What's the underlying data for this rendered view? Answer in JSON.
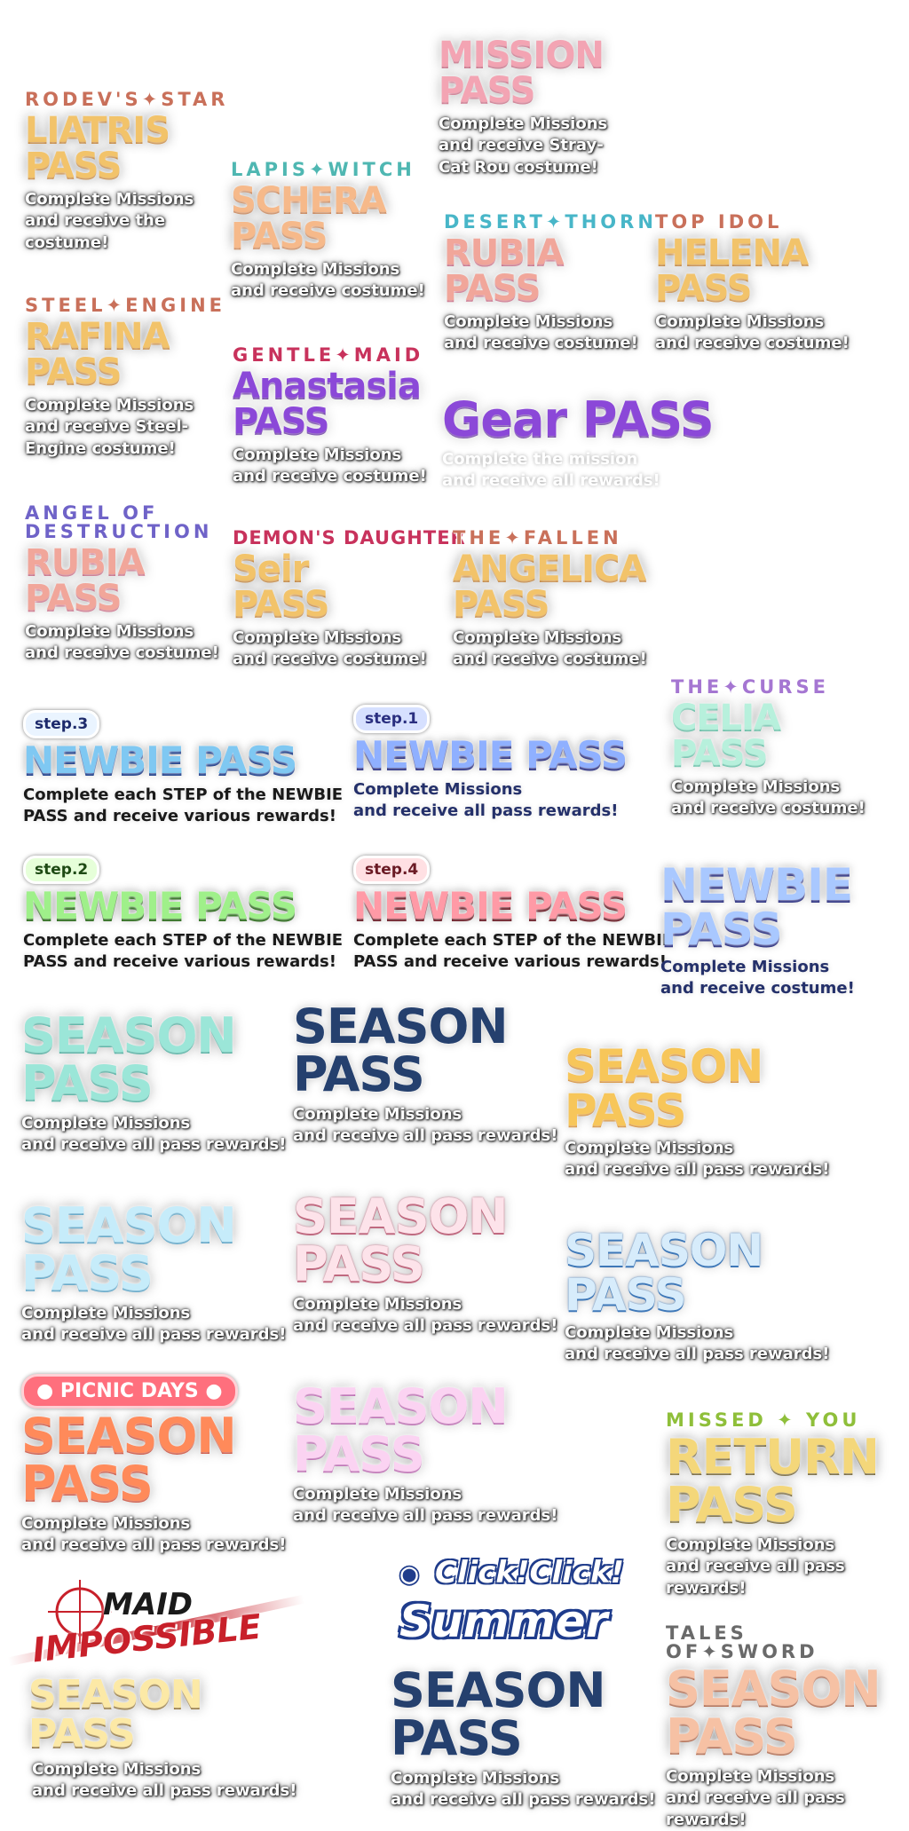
{
  "passes": {
    "liatris": {
      "sub": "RODEV'S✦STAR",
      "title1": "LIATRIS",
      "title2": "PASS",
      "desc1": "Complete Missions",
      "desc2": "and receive the",
      "desc3": "costume!"
    },
    "schera": {
      "sub": "LAPIS✦WITCH",
      "title1": "SCHERA",
      "title2": "PASS",
      "desc1": "Complete Missions",
      "desc2": "and receive costume!"
    },
    "mission": {
      "title1": "MISSION",
      "title2": "PASS",
      "desc1": "Complete Missions",
      "desc2": "and receive Stray-",
      "desc3": "Cat Rou costume!"
    },
    "rubia1": {
      "sub": "DESERT✦THORN",
      "title1": "RUBIA",
      "title2": "PASS",
      "desc1": "Complete Missions",
      "desc2": "and receive costume!"
    },
    "helena": {
      "sub": "TOP IDOL",
      "title1": "HELENA",
      "title2": "PASS",
      "desc1": "Complete Missions",
      "desc2": "and receive costume!"
    },
    "rafina": {
      "sub": "STEEL✦ENGINE",
      "title1": "RAFINA",
      "title2": "PASS",
      "desc1": "Complete Missions",
      "desc2": "and receive Steel-",
      "desc3": "Engine costume!"
    },
    "anastasia": {
      "sub": "GENTLE✦MAID",
      "title1": "Anastasia",
      "title2": "PASS",
      "desc1": "Complete Missions",
      "desc2": "and receive costume!"
    },
    "gear": {
      "title": "Gear PASS",
      "desc1": "Complete the mission",
      "desc2": "and receive all rewards!"
    },
    "rubia2": {
      "sub1": "ANGEL OF",
      "sub2": "DESTRUCTION",
      "title1": "RUBIA",
      "title2": "PASS",
      "desc1": "Complete Missions",
      "desc2": "and receive costume!"
    },
    "seir": {
      "sub": "DEMON'S DAUGHTER",
      "title1": "Seir",
      "title2": "PASS",
      "desc1": "Complete Missions",
      "desc2": "and receive costume!"
    },
    "angelica": {
      "sub": "THE✦FALLEN",
      "title1": "ANGELICA",
      "title2": "PASS",
      "desc1": "Complete Missions",
      "desc2": "and receive costume!"
    },
    "celia": {
      "sub": "THE✦CURSE",
      "title1": "CELIA",
      "title2": "PASS",
      "desc1": "Complete Missions",
      "desc2": "and receive costume!"
    }
  },
  "newbie": {
    "step3": {
      "step": "step.3",
      "title": "NEWBIE PASS",
      "desc1": "Complete each STEP of the NEWBIE",
      "desc2": "PASS and receive various rewards!"
    },
    "step1": {
      "step": "step.1",
      "title": "NEWBIE PASS",
      "desc1": "Complete Missions",
      "desc2": "and receive all pass rewards!"
    },
    "step2": {
      "step": "step.2",
      "title": "NEWBIE PASS",
      "desc1": "Complete each STEP of the NEWBIE",
      "desc2": "PASS and receive various rewards!"
    },
    "step4": {
      "step": "step.4",
      "title": "NEWBIE PASS",
      "desc1": "Complete each STEP of the NEWBIE",
      "desc2": "PASS and receive various rewards!"
    },
    "costume": {
      "title1": "NEWBIE",
      "title2": "PASS",
      "desc1": "Complete Missions",
      "desc2": "and receive costume!"
    }
  },
  "season": {
    "s1": {
      "title1": "SEASON",
      "title2": "PASS",
      "desc1": "Complete Missions",
      "desc2": "and receive all pass rewards!"
    },
    "s2": {
      "title1": "SEASON",
      "title2": "PASS",
      "desc1": "Complete Missions",
      "desc2": "and receive all pass rewards!"
    },
    "s3": {
      "title1": "SEASON",
      "title2": "PASS",
      "desc1": "Complete Missions",
      "desc2": "and receive all pass rewards!"
    },
    "s4": {
      "title1": "SEASON",
      "title2": "PASS",
      "desc1": "Complete Missions",
      "desc2": "and receive all pass rewards!"
    },
    "s5": {
      "title1": "SEASON",
      "title2": "PASS",
      "desc1": "Complete Missions",
      "desc2": "and receive all pass rewards!"
    },
    "s6": {
      "title1": "SEASON",
      "title2": "PASS",
      "desc1": "Complete Missions",
      "desc2": "and receive all pass rewards!"
    },
    "picnic": {
      "badge": "PICNIC DAYS",
      "title1": "SEASON",
      "title2": "PASS",
      "desc1": "Complete Missions",
      "desc2": "and receive all pass rewards!"
    },
    "s8": {
      "title1": "SEASON",
      "title2": "PASS",
      "desc1": "Complete Missions",
      "desc2": "and receive all pass rewards!"
    },
    "return": {
      "sub": "MISSED ✦ YOU",
      "title1": "RETURN",
      "title2": "PASS",
      "desc1": "Complete Missions",
      "desc2": "and receive all pass rewards!"
    },
    "maid": {
      "logo1": "MAID",
      "logo2": "IMPOSSIBLE",
      "title": "SEASON PASS",
      "desc1": "Complete Missions",
      "desc2": "and receive all pass rewards!"
    },
    "summer": {
      "logo1": "Click!Click!",
      "logo2": "Summer",
      "title1": "SEASON",
      "title2": "PASS",
      "desc1": "Complete Missions",
      "desc2": "and receive all pass rewards!"
    },
    "tales": {
      "sub": "TALES OF✦SWORD",
      "title1": "SEASON",
      "title2": "PASS",
      "desc1": "Complete Missions",
      "desc2": "and receive all pass rewards!"
    }
  }
}
